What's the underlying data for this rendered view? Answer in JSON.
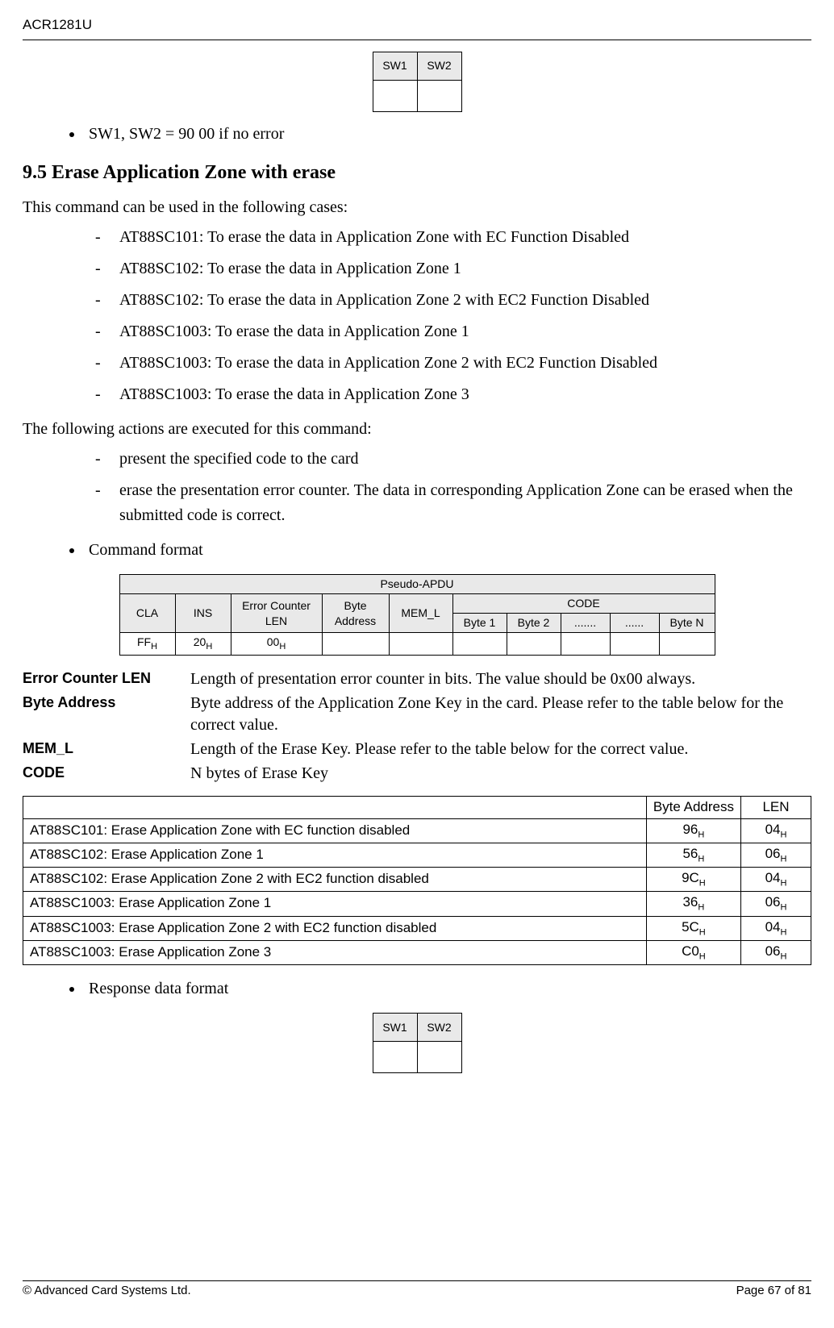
{
  "header": {
    "product": "ACR1281U"
  },
  "footer": {
    "left": "© Advanced Card Systems Ltd.",
    "right": "Page 67 of 81"
  },
  "sw_table": {
    "c1": "SW1",
    "c2": "SW2"
  },
  "bullet_sw": "SW1, SW2      = 90 00 if no error",
  "section_title": "9.5 Erase Application Zone with erase",
  "intro": "This command can be used in the following cases:",
  "cases": {
    "a": "AT88SC101: To erase the data in Application Zone with EC Function Disabled",
    "b": "AT88SC102: To erase the data in Application Zone 1",
    "c": "AT88SC102: To erase the data in Application Zone 2 with EC2 Function Disabled",
    "d": "AT88SC1003: To erase the data in Application Zone 1",
    "e": "AT88SC1003: To erase the data in Application Zone 2 with EC2 Function Disabled",
    "f": "AT88SC1003: To erase the data in Application Zone 3"
  },
  "actions_intro": "The following actions are executed for this command:",
  "actions": {
    "a": "present the specified code to the card",
    "b": "erase the presentation error counter.  The data in corresponding Application Zone can be erased when the submitted code is correct."
  },
  "bullet_cmd": "Command format",
  "apdu": {
    "title": "Pseudo-APDU",
    "cla": "CLA",
    "ins": "INS",
    "ecl": "Error Counter LEN",
    "ba": "Byte Address",
    "mem": "MEM_L",
    "code": "CODE",
    "b1": "Byte 1",
    "b2": "Byte 2",
    "d1": ".......",
    "d2": "......",
    "bn": "Byte N",
    "v_cla": "FF ",
    "v_ins": "20 ",
    "v_ecl": "00 ",
    "h": "H"
  },
  "defs": {
    "k1": "Error Counter LEN",
    "v1": "Length of presentation error counter in bits.  The value should be 0x00 always.",
    "k2": "Byte Address",
    "v2": "Byte address of the Application Zone Key in the card.  Please refer to the table below for the correct value.",
    "k3": "MEM_L",
    "v3": "Length of the Erase Key.  Please refer to the table below for the correct value.",
    "k4": "CODE",
    "v4": "N bytes of Erase Key"
  },
  "memtbl": {
    "h_ba": "Byte Address",
    "h_len": "LEN",
    "r": [
      {
        "t": "AT88SC101: Erase Application Zone with EC function disabled",
        "ba": "96 ",
        "len": "04 "
      },
      {
        "t": "AT88SC102: Erase Application Zone 1",
        "ba": "56 ",
        "len": "06 "
      },
      {
        "t": "AT88SC102: Erase Application Zone 2 with EC2 function disabled",
        "ba": "9C ",
        "len": "04 "
      },
      {
        "t": "AT88SC1003: Erase Application Zone 1",
        "ba": "36 ",
        "len": "06 "
      },
      {
        "t": "AT88SC1003: Erase Application Zone 2 with EC2 function disabled",
        "ba": "5C ",
        "len": "04 "
      },
      {
        "t": "AT88SC1003: Erase Application Zone 3",
        "ba": "C0 ",
        "len": "06 "
      }
    ],
    "h": "H"
  },
  "bullet_resp": "Response data format"
}
